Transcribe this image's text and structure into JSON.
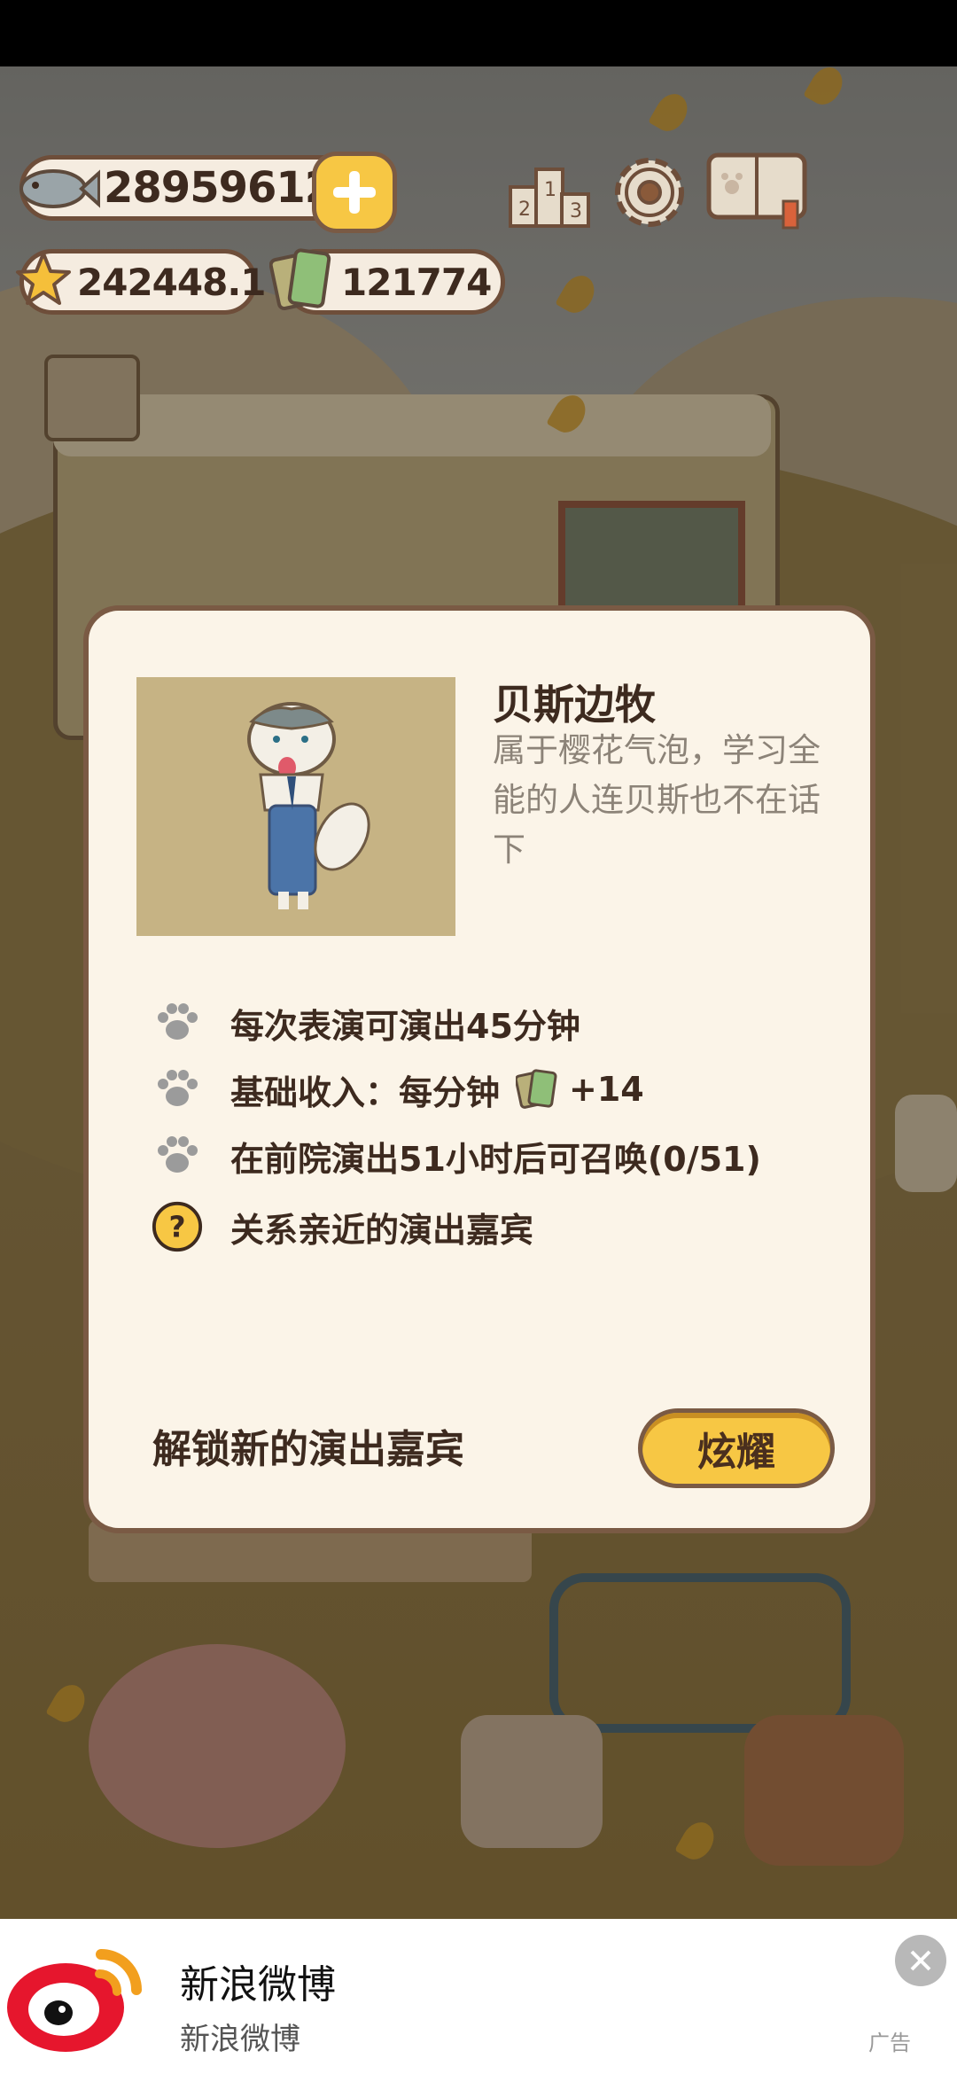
{
  "hud": {
    "fish_count": "28959612",
    "star_count": "242448.1",
    "ticket_count": "121774"
  },
  "dialog": {
    "character_name": "贝斯边牧",
    "description": "属于樱花气泡，学习全能的人连贝斯也不在话下",
    "stats": [
      {
        "icon": "paw-icon",
        "text": "每次表演可演出45分钟"
      },
      {
        "icon": "paw-icon",
        "text": "基础收入：每分钟",
        "suffix": "+14"
      },
      {
        "icon": "paw-icon",
        "text": "在前院演出51小时后可召唤(0/51)"
      },
      {
        "icon": "question-icon",
        "text": "关系亲近的演出嘉宾"
      }
    ],
    "unlock_text": "解锁新的演出嘉宾",
    "flaunt_button": "炫耀"
  },
  "ad": {
    "title": "新浪微博",
    "subtitle": "新浪微博",
    "tag": "广告"
  },
  "colors": {
    "accent": "#f7c744",
    "panel": "#fbf4e8",
    "border": "#7a5a44",
    "weibo_red": "#e6162d"
  }
}
